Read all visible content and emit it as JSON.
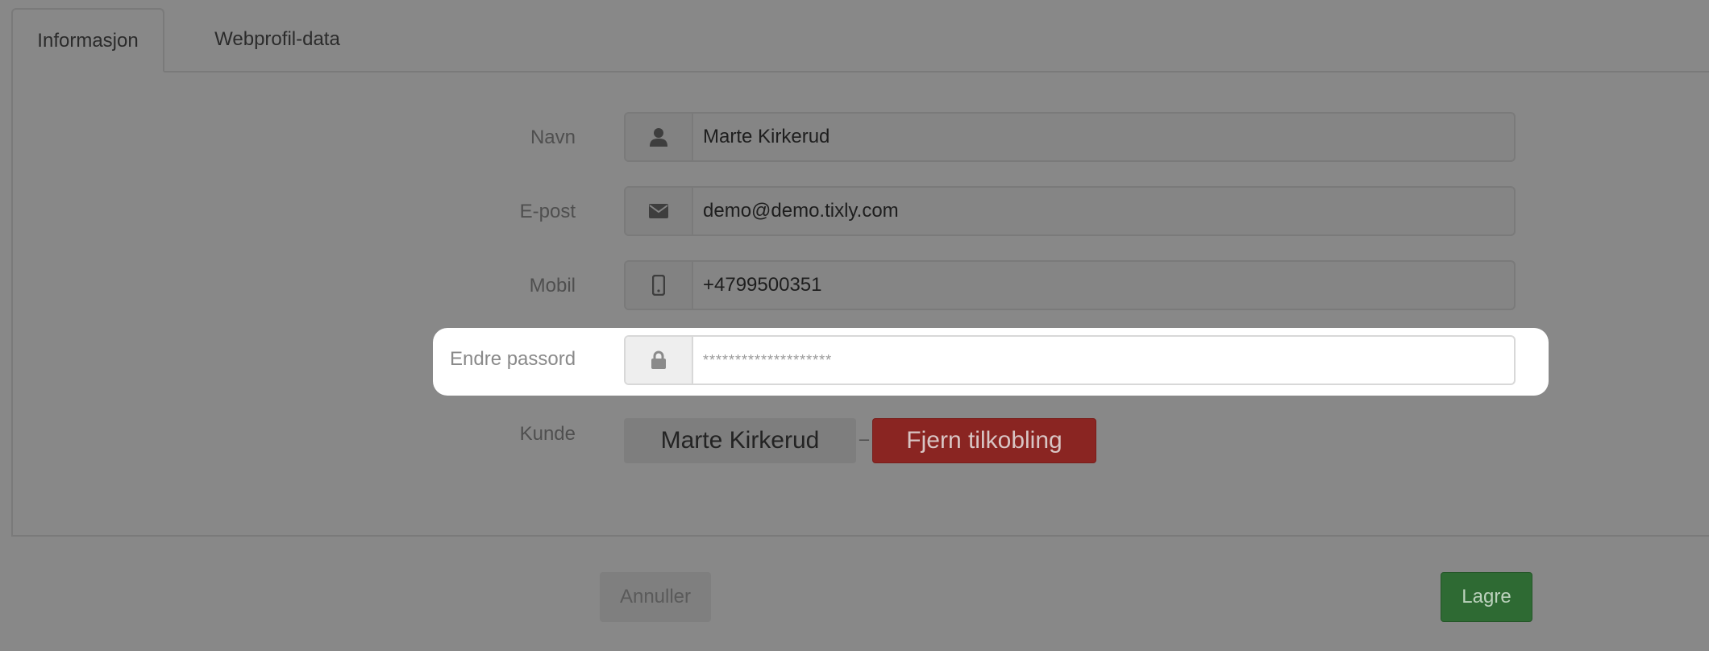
{
  "tabs": [
    {
      "label": "Informasjon",
      "active": true
    },
    {
      "label": "Webprofil-data",
      "active": false
    }
  ],
  "form": {
    "name": {
      "label": "Navn",
      "value": "Marte Kirkerud",
      "icon": "user-icon"
    },
    "email": {
      "label": "E-post",
      "value": "demo@demo.tixly.com",
      "icon": "envelope-icon"
    },
    "mobile": {
      "label": "Mobil",
      "value": "+4799500351",
      "icon": "mobile-phone-icon"
    },
    "password": {
      "label": "Endre passord",
      "placeholder": "********************",
      "icon": "lock-icon"
    },
    "customer": {
      "label": "Kunde",
      "name": "Marte Kirkerud",
      "separator": "–",
      "unlink_label": "Fjern tilkobling"
    }
  },
  "actions": {
    "cancel_label": "Annuller",
    "save_label": "Lagre"
  },
  "colors": {
    "overlay_gray": "#888888",
    "danger": "#8a2522",
    "success": "#2e6a33",
    "highlight": "#ffffff"
  }
}
